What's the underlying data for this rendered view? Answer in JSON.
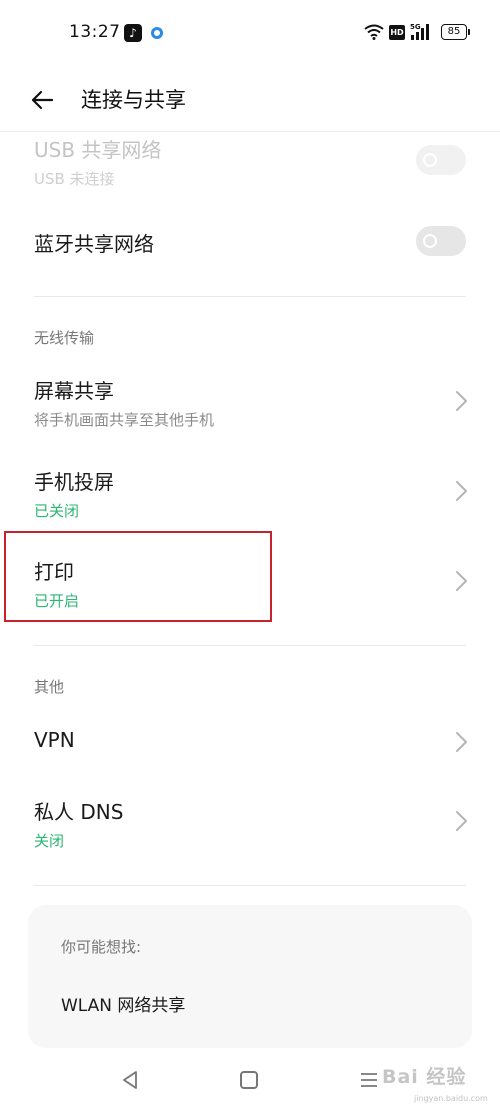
{
  "status_bar": {
    "time": "13:27",
    "icons": [
      "tiktok-icon",
      "notification-dot-icon",
      "wifi-icon",
      "hd-icon",
      "signal-5g-icon",
      "battery-icon"
    ],
    "hd_label": "HD",
    "network_label": "5G",
    "battery": "85"
  },
  "header": {
    "title": "连接与共享",
    "back_icon": "arrow-left-icon"
  },
  "rows": {
    "usb_tethering": {
      "title": "USB 共享网络",
      "subtitle": "USB 未连接",
      "enabled": false,
      "toggle_on": false
    },
    "bt_tethering": {
      "title": "蓝牙共享网络",
      "toggle_on": false
    }
  },
  "wireless": {
    "header": "无线传输",
    "screen_share": {
      "title": "屏幕共享",
      "subtitle": "将手机画面共享至其他手机"
    },
    "cast": {
      "title": "手机投屏",
      "subtitle": "已关闭"
    },
    "print": {
      "title": "打印",
      "subtitle": "已开启"
    }
  },
  "other": {
    "header": "其他",
    "vpn": {
      "title": "VPN"
    },
    "dns": {
      "title": "私人 DNS",
      "subtitle": "关闭"
    }
  },
  "suggestions": {
    "title": "你可能想找:",
    "items": [
      "WLAN 网络共享"
    ]
  },
  "watermark": {
    "brand": "Bai 经验",
    "url": "jingyan.baidu.com"
  },
  "colors": {
    "accent_green": "#2bb673",
    "highlight_red": "#c8222e"
  }
}
